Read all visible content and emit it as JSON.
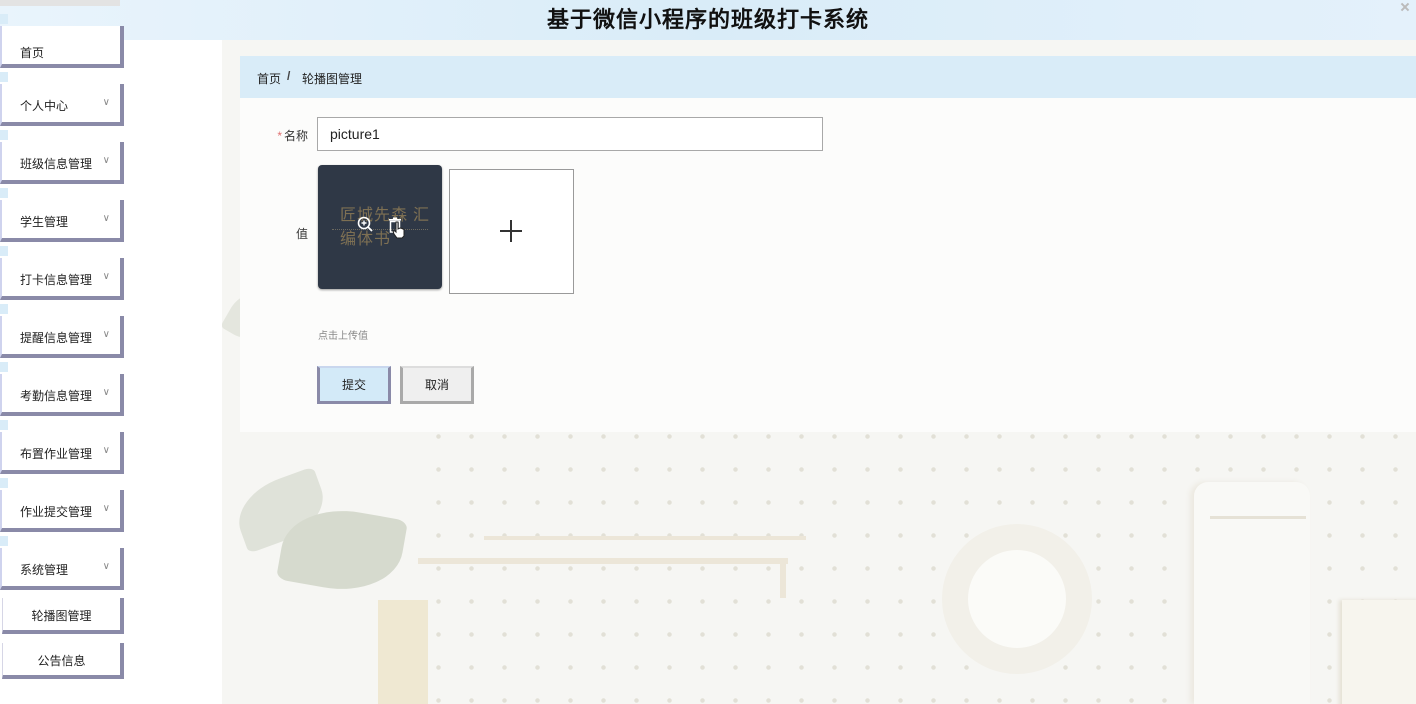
{
  "app": {
    "title": "基于微信小程序的班级打卡系统"
  },
  "sidebar": {
    "items": [
      {
        "label": "首页",
        "has_arrow": false
      },
      {
        "label": "个人中心",
        "has_arrow": true
      },
      {
        "label": "班级信息管理",
        "has_arrow": true
      },
      {
        "label": "学生管理",
        "has_arrow": true
      },
      {
        "label": "打卡信息管理",
        "has_arrow": true
      },
      {
        "label": "提醒信息管理",
        "has_arrow": true
      },
      {
        "label": "考勤信息管理",
        "has_arrow": true
      },
      {
        "label": "布置作业管理",
        "has_arrow": true
      },
      {
        "label": "作业提交管理",
        "has_arrow": true
      },
      {
        "label": "系统管理",
        "has_arrow": true
      }
    ],
    "subitems": [
      {
        "label": "轮播图管理"
      },
      {
        "label": "公告信息"
      }
    ]
  },
  "breadcrumb": {
    "home": "首页",
    "separator": "/",
    "current": "轮播图管理"
  },
  "form": {
    "name_required_mark": "*",
    "name_label": "名称",
    "name_value": "picture1",
    "value_label": "值",
    "upload_hint": "点击上传值",
    "submit_label": "提交",
    "cancel_label": "取消",
    "thumbnail_caption": "匠城先森 汇编体书"
  },
  "colors": {
    "accent_blue": "#d9ecf8",
    "sidebar_border": "#8a8aa8"
  }
}
